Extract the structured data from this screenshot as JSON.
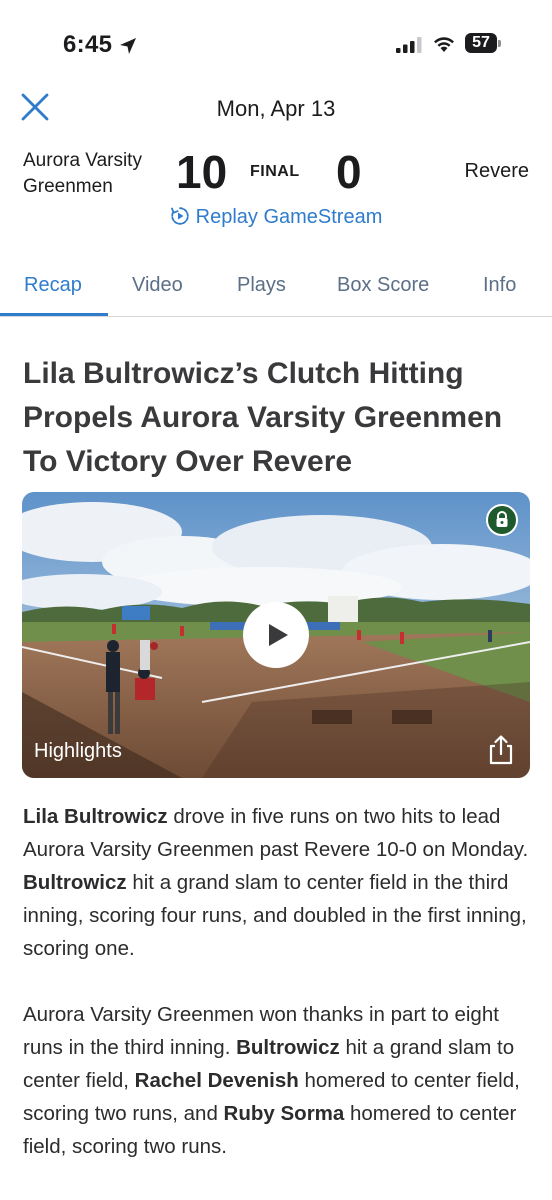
{
  "status_bar": {
    "time": "6:45",
    "battery": "57"
  },
  "header": {
    "date": "Mon, Apr 13"
  },
  "scoreboard": {
    "home_team_line1": "Aurora Varsity",
    "home_team_line2": "Greenmen",
    "home_score": "10",
    "status": "FINAL",
    "away_score": "0",
    "away_team": "Revere",
    "replay_label": "Replay GameStream"
  },
  "tabs": [
    {
      "label": "Recap",
      "active": true
    },
    {
      "label": "Video",
      "active": false
    },
    {
      "label": "Plays",
      "active": false
    },
    {
      "label": "Box Score",
      "active": false
    },
    {
      "label": "Info",
      "active": false
    }
  ],
  "article": {
    "headline": "Lila Bultrowicz’s Clutch Hitting Propels Aurora Varsity Greenmen To Victory Over Revere",
    "video_label": "Highlights",
    "paragraph1": [
      {
        "text": "Lila Bultrowicz",
        "bold": true
      },
      {
        "text": " drove in five runs on two hits to lead Aurora Varsity Greenmen past Revere 10-0 on Monday. ",
        "bold": false
      },
      {
        "text": "Bultrowicz",
        "bold": true
      },
      {
        "text": " hit a grand slam to center field in the third inning, scoring four runs, and doubled in the first inning, scoring one.",
        "bold": false
      }
    ],
    "paragraph2": [
      {
        "text": "Aurora Varsity Greenmen won thanks in part to eight runs in the third inning.  ",
        "bold": false
      },
      {
        "text": "Bultrowicz",
        "bold": true
      },
      {
        "text": " hit a grand slam to center field, ",
        "bold": false
      },
      {
        "text": "Rachel Devenish",
        "bold": true
      },
      {
        "text": " homered to center field, scoring two runs, and ",
        "bold": false
      },
      {
        "text": "Ruby Sorma",
        "bold": true
      },
      {
        "text": " homered to center field, scoring two runs.",
        "bold": false
      }
    ]
  },
  "colors": {
    "accent": "#2f7bcc",
    "lock_badge": "#1f5a2e",
    "tab_inactive": "#5b6f86"
  },
  "icons": {
    "close": "close-icon",
    "replay": "replay-icon",
    "lock": "lock-icon",
    "play": "play-icon",
    "share": "share-icon"
  }
}
